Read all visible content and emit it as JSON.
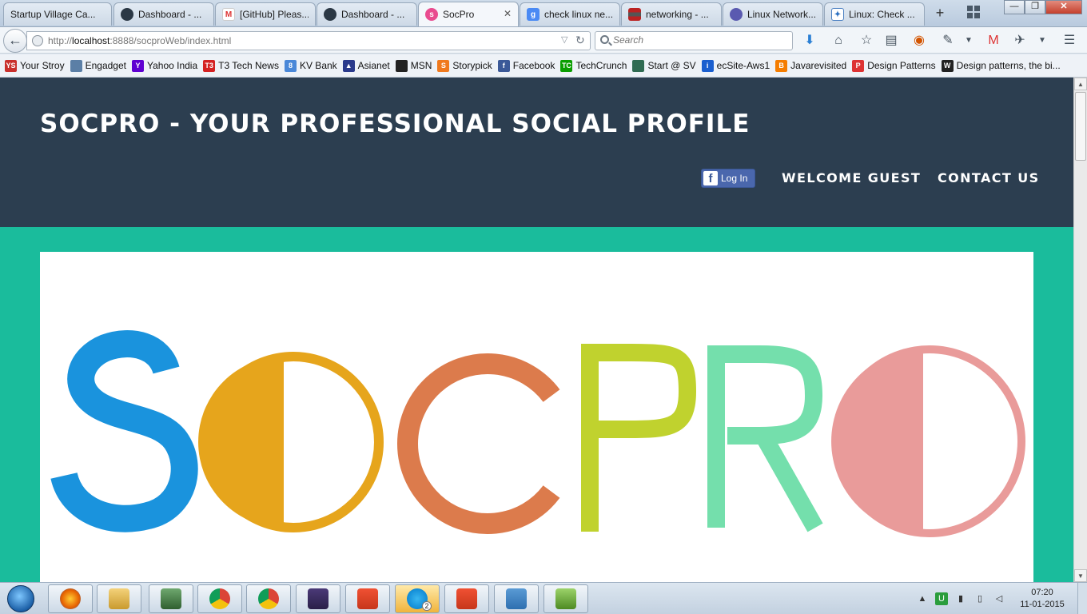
{
  "browser": {
    "tabs": [
      {
        "label": "Startup Village Ca...",
        "icon": "startup-village-icon",
        "active": false
      },
      {
        "label": "Dashboard - ...",
        "icon": "github-octocat-icon",
        "active": false
      },
      {
        "label": "[GitHub] Pleas...",
        "icon": "gmail-icon",
        "active": false
      },
      {
        "label": "Dashboard - ...",
        "icon": "github-octocat-icon",
        "active": false
      },
      {
        "label": "SocPro",
        "icon": "socpro-icon",
        "active": true
      },
      {
        "label": "check linux ne...",
        "icon": "google-icon",
        "active": false
      },
      {
        "label": "networking - ...",
        "icon": "stackexchange-icon",
        "active": false
      },
      {
        "label": "Linux Network...",
        "icon": "linux-icon",
        "active": false
      },
      {
        "label": "Linux: Check ...",
        "icon": "cyberciti-icon",
        "active": false
      }
    ],
    "url_prefix": "http://",
    "url_host": "localhost",
    "url_rest": ":8888/socproWeb/index.html",
    "search_placeholder": "Search",
    "window_buttons": {
      "minimize": "—",
      "restore": "❐",
      "close": "✕"
    }
  },
  "bookmarks": [
    {
      "label": "Your Stroy",
      "icon": "ys-icon",
      "color": "#c9302c",
      "glyph": "YS"
    },
    {
      "label": "Engadget",
      "icon": "engadget-icon",
      "color": "#5b7fa6",
      "glyph": ""
    },
    {
      "label": "Yahoo India",
      "icon": "yahoo-icon",
      "color": "#5f01d1",
      "glyph": "Y"
    },
    {
      "label": "T3 Tech News",
      "icon": "t3-icon",
      "color": "#d42222",
      "glyph": "T3"
    },
    {
      "label": "KV Bank",
      "icon": "kvbank-icon",
      "color": "#4a88d8",
      "glyph": "8"
    },
    {
      "label": "Asianet",
      "icon": "asianet-icon",
      "color": "#2a3a8c",
      "glyph": "▲"
    },
    {
      "label": "MSN",
      "icon": "msn-icon",
      "color": "#222222",
      "glyph": ""
    },
    {
      "label": "Storypick",
      "icon": "storypick-icon",
      "color": "#f07a1e",
      "glyph": "S"
    },
    {
      "label": "Facebook",
      "icon": "facebook-icon",
      "color": "#3b5998",
      "glyph": "f"
    },
    {
      "label": "TechCrunch",
      "icon": "techcrunch-icon",
      "color": "#0a9e01",
      "glyph": "TC"
    },
    {
      "label": "Start @ SV",
      "icon": "startsv-icon",
      "color": "#2f6b52",
      "glyph": ""
    },
    {
      "label": "ecSite-Aws1",
      "icon": "ecsite-icon",
      "color": "#1a5fcf",
      "glyph": "i"
    },
    {
      "label": "Javarevisited",
      "icon": "blogger-icon",
      "color": "#f57d00",
      "glyph": "B"
    },
    {
      "label": "Design Patterns",
      "icon": "design-patterns-icon",
      "color": "#d33",
      "glyph": "P"
    },
    {
      "label": "Design patterns, the bi...",
      "icon": "wikipedia-icon",
      "color": "#222",
      "glyph": "W"
    }
  ],
  "page": {
    "site_title": "SOCPRO - YOUR PROFESSIONAL SOCIAL PROFILE",
    "fb_login_label": "Log In",
    "nav": {
      "welcome": "WELCOME GUEST",
      "contact": "CONTACT US"
    },
    "logo_text": "SOCPRO",
    "colors": {
      "header_bg": "#2c3e50",
      "body_bg": "#1abc9c",
      "logo_s": "#1a93dd",
      "logo_o1": "#e6a51c",
      "logo_c": "#dc7b4c",
      "logo_p": "#c0d22e",
      "logo_r": "#74dfac",
      "logo_o2": "#e99b9a"
    }
  },
  "taskbar": {
    "apps": [
      "firefox-icon",
      "explorer-icon",
      "task-manager-icon",
      "chrome-icon",
      "chrome-icon",
      "eclipse-javaee-icon",
      "git-icon",
      "skype-icon",
      "git-icon",
      "remote-desktop-icon",
      "notepad-plus-icon"
    ],
    "skype_badge": "2",
    "clock_time": "07:20",
    "clock_date": "11-01-2015"
  }
}
